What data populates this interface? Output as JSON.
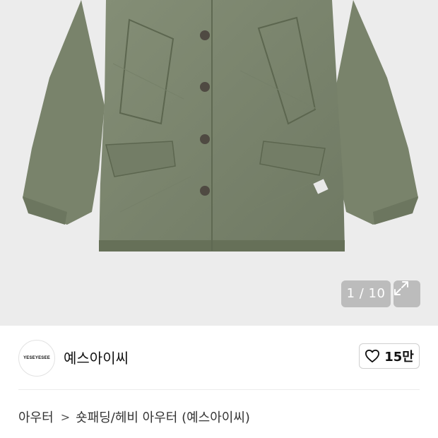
{
  "image_counter": {
    "text": "1 / 10",
    "current": 1,
    "total": 10
  },
  "icons": {
    "expand": "expand-arrows-icon",
    "like": "heart-outline-icon"
  },
  "brand": {
    "logo_text": "YESEYESEE",
    "name": "예스아이씨"
  },
  "like": {
    "count": "15만"
  },
  "breadcrumb": {
    "category": "아우터",
    "subcategory": "숏패딩/헤비 아우터 (예스아이씨)"
  },
  "colors": {
    "hero_background": "#ececec",
    "jacket": "#7d8770",
    "accent_text": "#111111"
  }
}
